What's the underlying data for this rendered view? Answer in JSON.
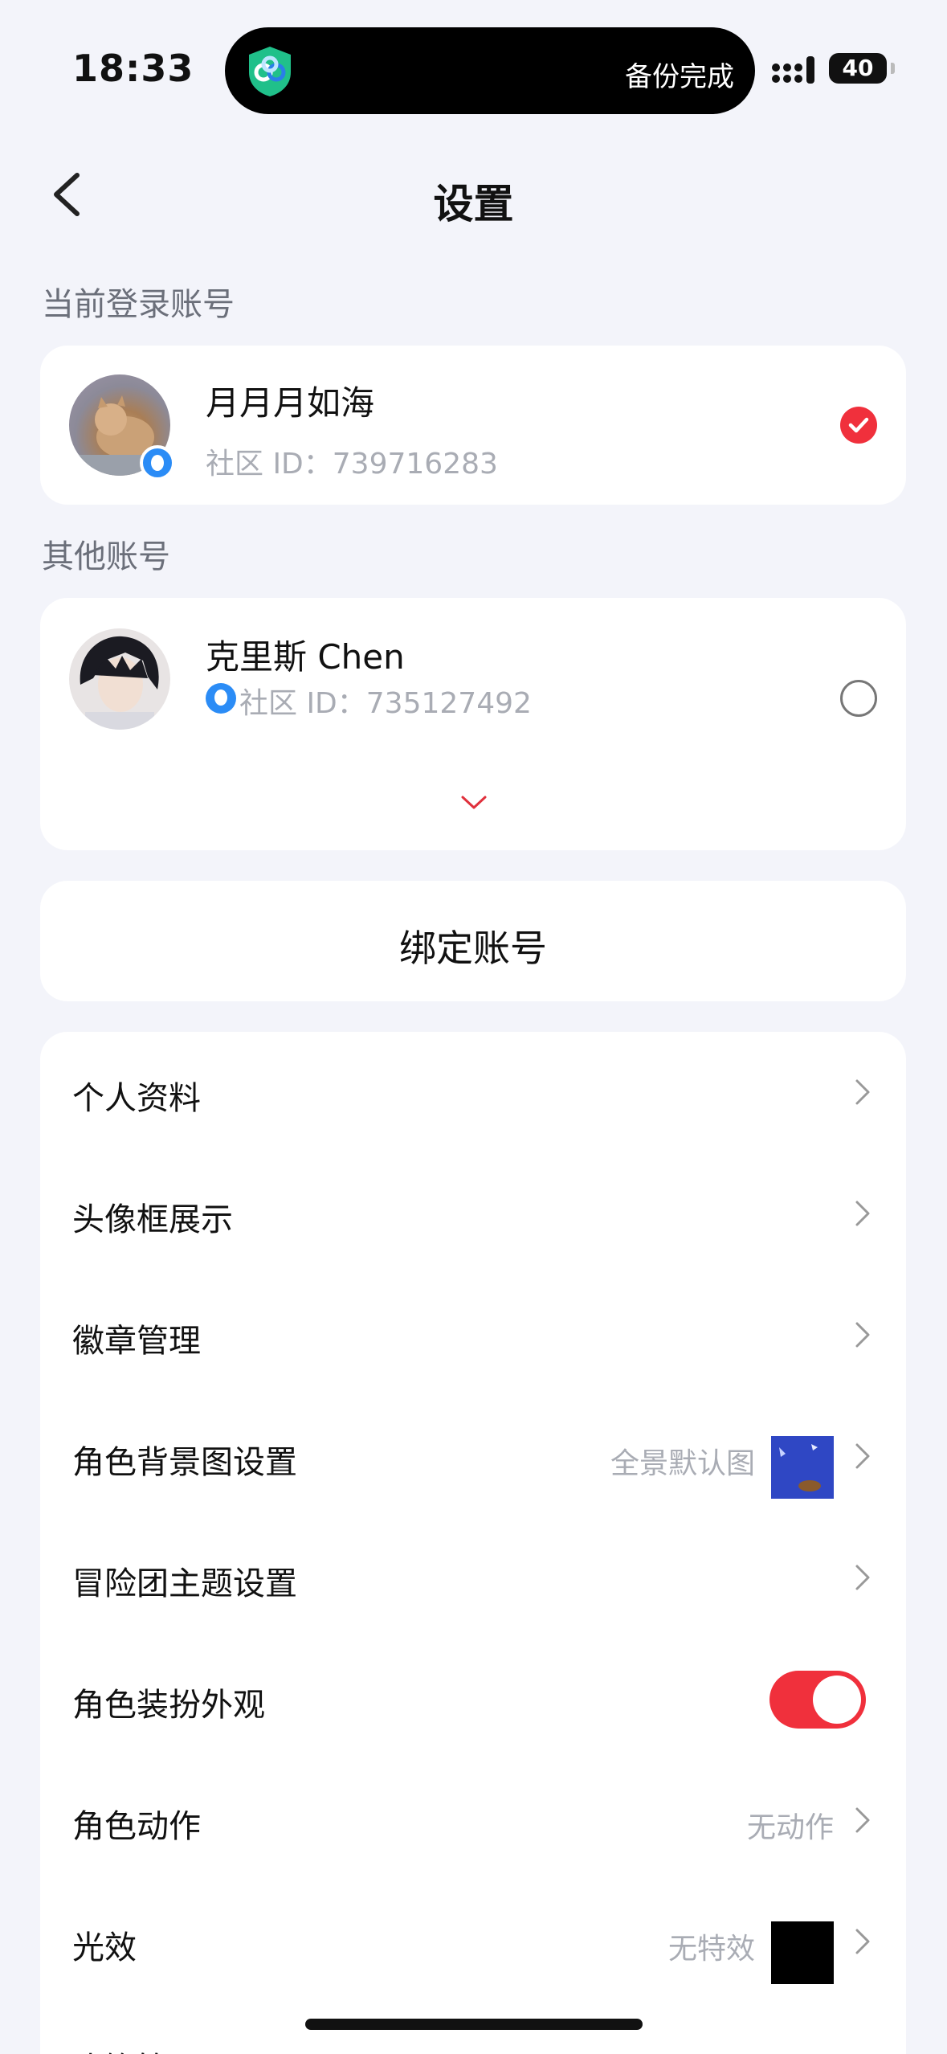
{
  "status_bar": {
    "time": "18:33",
    "island_text": "备份完成",
    "battery": "40"
  },
  "nav": {
    "title": "设置"
  },
  "current_account": {
    "section_label": "当前登录账号",
    "name": "月月月如海",
    "id_text": "社区 ID：739716283",
    "selected": true
  },
  "other_accounts": {
    "section_label": "其他账号",
    "items": [
      {
        "name": "克里斯 Chen",
        "id_text": "社区 ID：735127492",
        "selected": false
      }
    ]
  },
  "bind_button": {
    "label": "绑定账号"
  },
  "menu": {
    "items": [
      {
        "label": "个人资料"
      },
      {
        "label": "头像框展示"
      },
      {
        "label": "徽章管理"
      },
      {
        "label": "角色背景图设置",
        "value": "全景默认图"
      },
      {
        "label": "冒险团主题设置"
      },
      {
        "label": "角色装扮外观",
        "toggle": true
      },
      {
        "label": "角色动作",
        "value": "无动作"
      },
      {
        "label": "光效",
        "value": "无特效"
      },
      {
        "label": "头饰管理"
      }
    ]
  },
  "colors": {
    "accent": "#f0303c",
    "background": "#f3f4fa",
    "card": "#ffffff",
    "secondary_text": "#a9acb4",
    "qq_blue": "#2b8cf6"
  }
}
